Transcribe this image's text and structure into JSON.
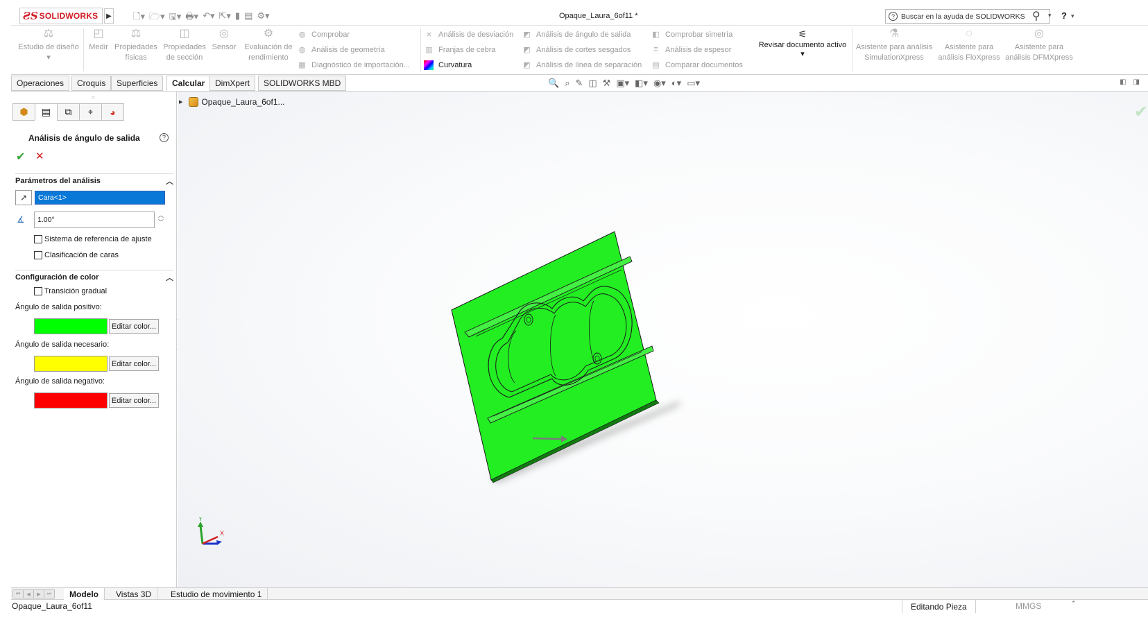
{
  "app": {
    "logo_ds": "ƧS",
    "logo_text": "SOLIDWORKS",
    "document_title": "Opaque_Laura_6of11 *",
    "help_search_placeholder": "Buscar en la ayuda de SOLIDWORKS",
    "help_label": "?"
  },
  "ribbon": {
    "big_buttons": [
      {
        "label": "Estudio de diseño",
        "icon": "design-study-icon",
        "dropdown": "▾"
      },
      {
        "label": "Medir",
        "icon": "measure-icon"
      },
      {
        "label": "Propiedades físicas",
        "icon": "mass-properties-icon"
      },
      {
        "label": "Propiedades de sección",
        "icon": "section-properties-icon"
      },
      {
        "label": "Sensor",
        "icon": "sensor-icon"
      },
      {
        "label": "Evaluación de rendimiento",
        "icon": "performance-evaluation-icon"
      }
    ],
    "col1": [
      "Comprobar",
      "Análisis de geometría",
      "Diagnóstico de importación..."
    ],
    "col2": [
      "Análisis de desviación",
      "Franjas de cebra",
      "Curvatura"
    ],
    "col3": [
      "Análisis de ángulo de salida",
      "Análisis de cortes sesgados",
      "Análisis de línea de separación"
    ],
    "col4": [
      "Comprobar simetría",
      "Análisis de espesor",
      "Comparar documentos"
    ],
    "review": {
      "label": "Revisar documento activo",
      "dropdown": "▾"
    },
    "wizards": [
      {
        "line1": "Asistente para análisis",
        "line2": "SimulationXpress"
      },
      {
        "line1": "Asistente para",
        "line2": "análisis FloXpress"
      },
      {
        "line1": "Asistente para",
        "line2": "análisis DFMXpress"
      }
    ]
  },
  "tabs": [
    "Operaciones",
    "Croquis",
    "Superficies",
    "Calcular",
    "DimXpert",
    "SOLIDWORKS MBD"
  ],
  "active_tab": "Calcular",
  "panel": {
    "title": "Análisis de ángulo de salida",
    "ok": "✔",
    "cancel": "✕",
    "group1": "Parámetros del análisis",
    "selection": "Cara<1>",
    "angle": "1.00°",
    "chk_reference": "Sistema de referencia de ajuste",
    "chk_face_class": "Clasificación de caras",
    "group2": "Configuración de color",
    "chk_gradual": "Transición gradual",
    "positive_label": "Ángulo de salida positivo:",
    "required_label": "Ángulo de salida necesario:",
    "negative_label": "Ángulo de salida negativo:",
    "edit_color": "Editar color...",
    "colors": {
      "positive": "#00ff00",
      "required": "#ffff00",
      "negative": "#ff0000"
    }
  },
  "graphics": {
    "tree_node": "Opaque_Laura_6of1...",
    "triad_y": "Y",
    "triad_x": "X"
  },
  "bottom_tabs": [
    "Modelo",
    "Vistas 3D",
    "Estudio de movimiento 1"
  ],
  "status": {
    "document": "Opaque_Laura_6of11",
    "mode": "Editando Pieza",
    "units": "MMGS"
  }
}
